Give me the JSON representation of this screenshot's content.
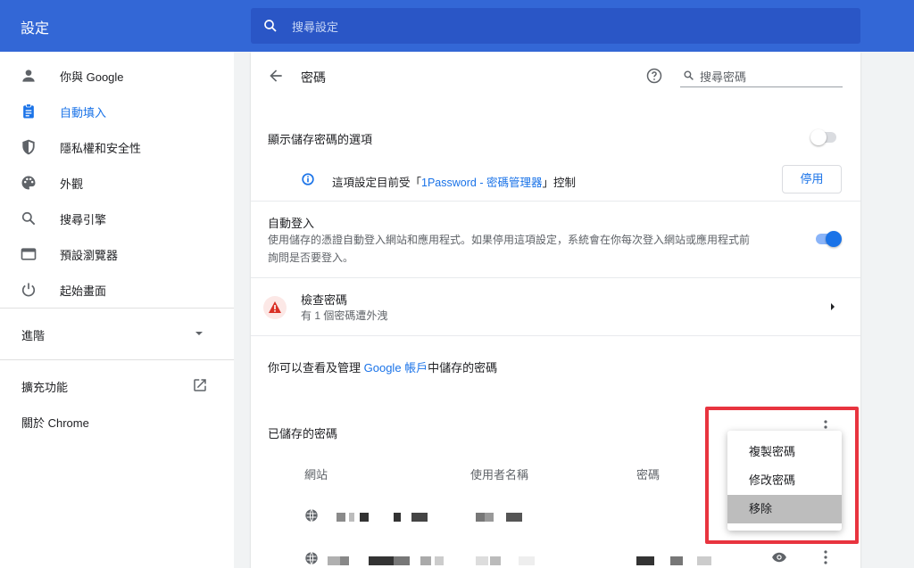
{
  "header": {
    "title": "設定",
    "search_placeholder": "搜尋設定"
  },
  "sidebar": {
    "items": [
      {
        "label": "你與 Google",
        "icon": "person-icon"
      },
      {
        "label": "自動填入",
        "icon": "assignment-icon"
      },
      {
        "label": "隱私權和安全性",
        "icon": "shield-icon"
      },
      {
        "label": "外觀",
        "icon": "palette-icon"
      },
      {
        "label": "搜尋引擎",
        "icon": "search-icon"
      },
      {
        "label": "預設瀏覽器",
        "icon": "browser-icon"
      },
      {
        "label": "起始畫面",
        "icon": "power-icon"
      }
    ],
    "advanced_label": "進階",
    "extensions_label": "擴充功能",
    "about_label": "關於 Chrome"
  },
  "page": {
    "title": "密碼",
    "search_placeholder": "搜尋密碼",
    "offer_to_save": "顯示儲存密碼的選項",
    "managed_prefix": "這項設定目前受「",
    "managed_link": "1Password - 密碼管理器",
    "managed_suffix": "」控制",
    "disable_button": "停用",
    "auto_signin_title": "自動登入",
    "auto_signin_desc_1": "使用儲存的憑證自動登入網站和應用程式。如果停用這項設定，系統會在你每次登入網站或應用程式前",
    "auto_signin_desc_2": "詢問是否要登入。",
    "check_title": "檢查密碼",
    "check_sub": "有 1 個密碼遭外洩",
    "manage_prefix": "你可以查看及管理 ",
    "manage_link": "Google 帳戶",
    "manage_suffix": "中儲存的密碼",
    "saved_title": "已儲存的密碼",
    "columns": [
      "網站",
      "使用者名稱",
      "密碼"
    ]
  },
  "menu": {
    "items": [
      "複製密碼",
      "修改密碼",
      "移除"
    ]
  },
  "colors": {
    "header_blue": "#3367d6",
    "accent": "#1a73e8",
    "highlight_frame": "#e8343f"
  }
}
